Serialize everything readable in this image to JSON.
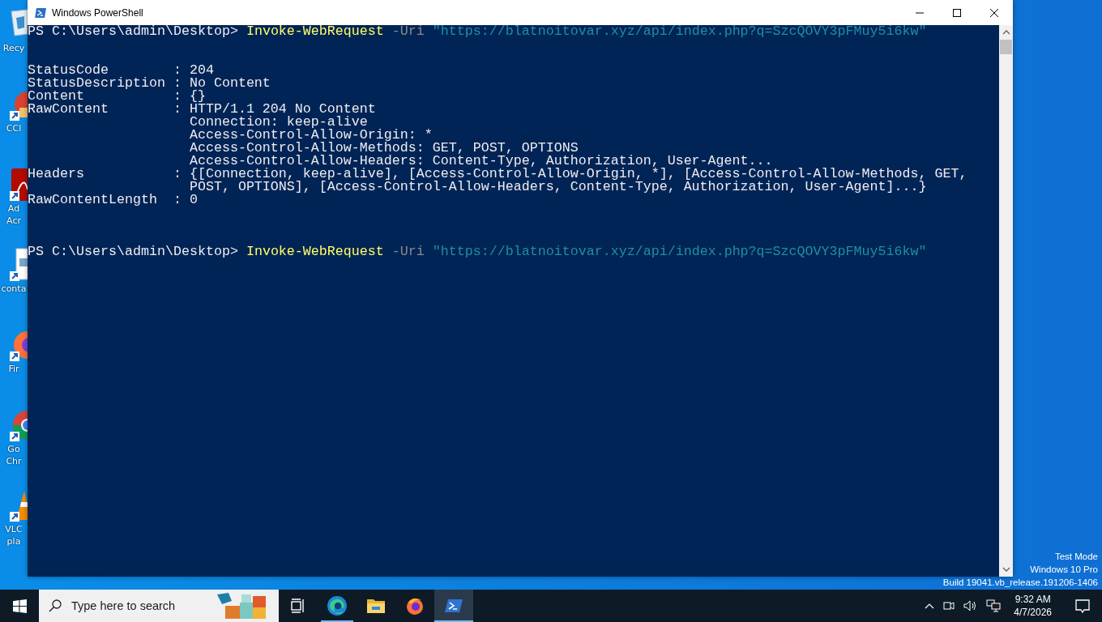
{
  "desktop_icons": [
    {
      "kind": "recycle",
      "shortcut": false,
      "label_lines": [
        "Recy"
      ]
    },
    {
      "kind": "ccleaner",
      "shortcut": true,
      "label_lines": [
        "CCl"
      ]
    },
    {
      "kind": "acrobat",
      "shortcut": true,
      "label_lines": [
        "Ad",
        "Acr"
      ]
    },
    {
      "kind": "file",
      "shortcut": true,
      "label_lines": [
        "conta"
      ]
    },
    {
      "kind": "firefox",
      "shortcut": true,
      "label_lines": [
        "Fir"
      ]
    },
    {
      "kind": "chrome",
      "shortcut": true,
      "label_lines": [
        "Go",
        "Chr"
      ]
    },
    {
      "kind": "vlc",
      "shortcut": true,
      "label_lines": [
        "VLC",
        "pla"
      ]
    }
  ],
  "window": {
    "title": "Windows PowerShell"
  },
  "console": {
    "lines": [
      {
        "kind": "command",
        "prompt": "PS C:\\Users\\admin\\Desktop>",
        "cmdlet": "Invoke-WebRequest",
        "parameter": "-Uri",
        "argument": "\"https://blatnoitovar.xyz/api/index.php?q=SzcQOVY3pFMuy5i6kw\""
      },
      {
        "kind": "blank"
      },
      {
        "kind": "blank"
      },
      {
        "kind": "output",
        "text": "StatusCode        : 204"
      },
      {
        "kind": "output",
        "text": "StatusDescription : No Content"
      },
      {
        "kind": "output",
        "text": "Content           : {}"
      },
      {
        "kind": "output",
        "text": "RawContent        : HTTP/1.1 204 No Content"
      },
      {
        "kind": "output",
        "text": "                    Connection: keep-alive"
      },
      {
        "kind": "output",
        "text": "                    Access-Control-Allow-Origin: *"
      },
      {
        "kind": "output",
        "text": "                    Access-Control-Allow-Methods: GET, POST, OPTIONS"
      },
      {
        "kind": "output",
        "text": "                    Access-Control-Allow-Headers: Content-Type, Authorization, User-Agent..."
      },
      {
        "kind": "output",
        "text": "Headers           : {[Connection, keep-alive], [Access-Control-Allow-Origin, *], [Access-Control-Allow-Methods, GET,"
      },
      {
        "kind": "output",
        "text": "                    POST, OPTIONS], [Access-Control-Allow-Headers, Content-Type, Authorization, User-Agent]...}"
      },
      {
        "kind": "output",
        "text": "RawContentLength  : 0"
      },
      {
        "kind": "blank"
      },
      {
        "kind": "blank"
      },
      {
        "kind": "blank"
      },
      {
        "kind": "command",
        "prompt": "PS C:\\Users\\admin\\Desktop>",
        "cmdlet": "Invoke-WebRequest",
        "parameter": "-Uri",
        "argument": "\"https://blatnoitovar.xyz/api/index.php?q=SzcQOVY3pFMuy5i6kw\""
      }
    ]
  },
  "desktop_watermark": [
    "Test Mode",
    "Windows 10 Pro",
    "Build 19041.vb_release.191206-1406"
  ],
  "taskbar": {
    "search": {
      "placeholder": "Type here to search"
    },
    "apps": [
      {
        "kind": "task-view",
        "running": false,
        "selected": false
      },
      {
        "kind": "edge",
        "running": true,
        "selected": false
      },
      {
        "kind": "explorer",
        "running": false,
        "selected": false
      },
      {
        "kind": "firefox",
        "running": false,
        "selected": false
      },
      {
        "kind": "powershell",
        "running": true,
        "selected": true
      }
    ],
    "clock": {
      "time": "9:32 AM",
      "date": "4/7/2026"
    }
  }
}
